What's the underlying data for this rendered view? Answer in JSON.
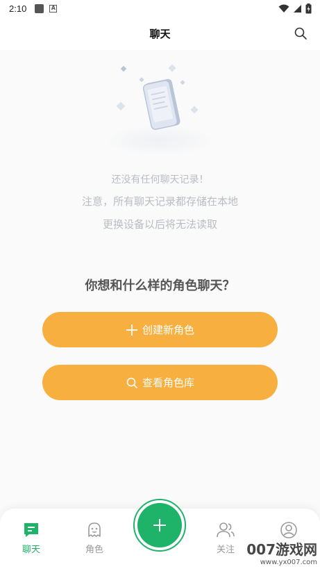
{
  "status": {
    "time": "2:10"
  },
  "header": {
    "title": "聊天"
  },
  "empty": {
    "line1": "还没有任何聊天记录！",
    "line2": "注意，所有聊天记录都存储在本地",
    "line3": "更换设备以后将无法读取"
  },
  "prompt": {
    "question": "你想和什么样的角色聊天？"
  },
  "actions": {
    "create_label": "创建新角色",
    "browse_label": "查看角色库"
  },
  "tabs": [
    {
      "label": "聊天",
      "icon": "chat-icon",
      "active": true
    },
    {
      "label": "角色",
      "icon": "ghost-icon",
      "active": false
    },
    {
      "label": "",
      "icon": "plus-icon",
      "active": false
    },
    {
      "label": "关注",
      "icon": "users-icon",
      "active": false
    },
    {
      "label": "",
      "icon": "profile-icon",
      "active": false
    }
  ],
  "watermark": {
    "main": "007游戏网",
    "sub": "www.yx007.com"
  },
  "colors": {
    "accent": "#1fb36a",
    "button": "#f7b03f"
  }
}
